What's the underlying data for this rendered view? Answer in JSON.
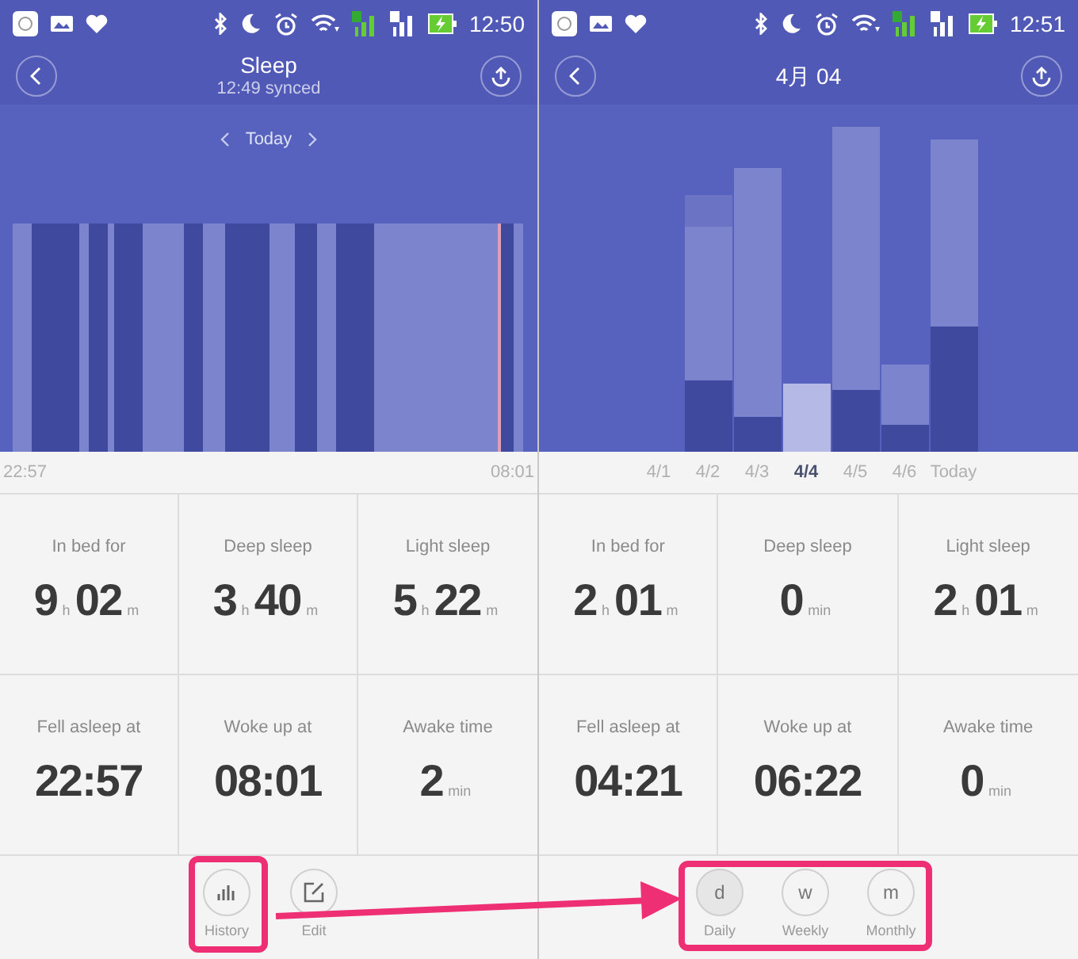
{
  "panels": [
    {
      "status_bar": {
        "time": "12:50"
      },
      "header": {
        "title": "Sleep",
        "subtitle": "12:49 synced"
      },
      "date_nav": {
        "label": "Today"
      },
      "chart": {
        "kind": "timeline"
      },
      "axis_labels": [
        {
          "text": "22:57",
          "selected": false
        },
        {
          "text": "08:01",
          "selected": false
        }
      ],
      "stats": [
        {
          "label": "In bed for",
          "parts": [
            {
              "n": "9",
              "u": "h"
            },
            {
              "n": "02",
              "u": "m"
            }
          ]
        },
        {
          "label": "Deep sleep",
          "parts": [
            {
              "n": "3",
              "u": "h"
            },
            {
              "n": "40",
              "u": "m"
            }
          ]
        },
        {
          "label": "Light sleep",
          "parts": [
            {
              "n": "5",
              "u": "h"
            },
            {
              "n": "22",
              "u": "m"
            }
          ]
        },
        {
          "label": "Fell asleep at",
          "parts": [
            {
              "n": "22:57"
            }
          ]
        },
        {
          "label": "Woke up at",
          "parts": [
            {
              "n": "08:01"
            }
          ]
        },
        {
          "label": "Awake time",
          "parts": [
            {
              "n": "2",
              "u": "min"
            }
          ]
        }
      ],
      "buttons": [
        {
          "kind": "history",
          "label": "History",
          "selected": false,
          "highlighted": true
        },
        {
          "kind": "edit",
          "label": "Edit",
          "selected": false,
          "highlighted": false
        }
      ]
    },
    {
      "status_bar": {
        "time": "12:51"
      },
      "header": {
        "title": "4月 04"
      },
      "chart": {
        "kind": "bars"
      },
      "axis_labels": [
        {
          "text": "4/1",
          "selected": false
        },
        {
          "text": "4/2",
          "selected": false
        },
        {
          "text": "4/3",
          "selected": false
        },
        {
          "text": "4/4",
          "selected": true
        },
        {
          "text": "4/5",
          "selected": false
        },
        {
          "text": "4/6",
          "selected": false
        },
        {
          "text": "Today",
          "selected": false
        }
      ],
      "stats": [
        {
          "label": "In bed for",
          "parts": [
            {
              "n": "2",
              "u": "h"
            },
            {
              "n": "01",
              "u": "m"
            }
          ]
        },
        {
          "label": "Deep sleep",
          "parts": [
            {
              "n": "0",
              "u": "min"
            }
          ]
        },
        {
          "label": "Light sleep",
          "parts": [
            {
              "n": "2",
              "u": "h"
            },
            {
              "n": "01",
              "u": "m"
            }
          ]
        },
        {
          "label": "Fell asleep at",
          "parts": [
            {
              "n": "04:21"
            }
          ]
        },
        {
          "label": "Woke up at",
          "parts": [
            {
              "n": "06:22"
            }
          ]
        },
        {
          "label": "Awake time",
          "parts": [
            {
              "n": "0",
              "u": "min"
            }
          ]
        }
      ],
      "buttons": [
        {
          "kind": "period",
          "label": "Daily",
          "letter": "d",
          "selected": true
        },
        {
          "kind": "period",
          "label": "Weekly",
          "letter": "w",
          "selected": false
        },
        {
          "kind": "period",
          "label": "Monthly",
          "letter": "m",
          "selected": false
        }
      ],
      "buttons_highlighted": true
    }
  ]
}
